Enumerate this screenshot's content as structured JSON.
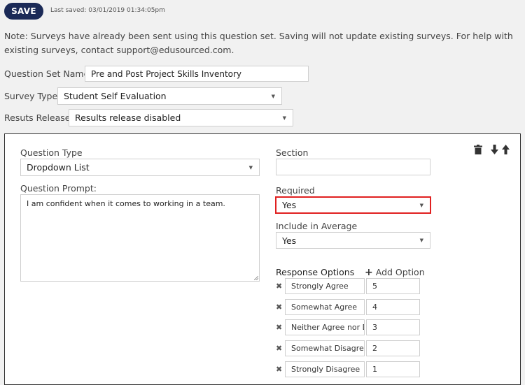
{
  "toolbar": {
    "save_label": "SAVE",
    "last_saved": "Last saved: 03/01/2019 01:34:05pm"
  },
  "note": "Note: Surveys have already been sent using this question set. Saving will not update existing surveys. For help with existing surveys, contact support@edusourced.com.",
  "question_set": {
    "label": "Question Set Name:",
    "value": "Pre and Post Project Skills Inventory"
  },
  "survey_type": {
    "label": "Survey Type:",
    "value": "Student Self Evaluation"
  },
  "results_release": {
    "label": "Resuts Release:",
    "value": "Results release disabled"
  },
  "question": {
    "type_label": "Question Type",
    "type_value": "Dropdown List",
    "prompt_label": "Question Prompt:",
    "prompt_value": "I am confident when it comes to working in a team.",
    "section_label": "Section",
    "section_value": "",
    "required_label": "Required",
    "required_value": "Yes",
    "include_label": "Include in Average",
    "include_value": "Yes",
    "response_label": "Response Options",
    "add_option_label": "Add Option",
    "options": [
      {
        "text": "Strongly Agree",
        "value": "5"
      },
      {
        "text": "Somewhat Agree",
        "value": "4"
      },
      {
        "text": "Neither Agree nor Di",
        "value": "3"
      },
      {
        "text": "Somewhat Disagree",
        "value": "2"
      },
      {
        "text": "Strongly Disagree",
        "value": "1"
      }
    ]
  },
  "colors": {
    "save_bg": "#1b2a57",
    "highlight": "#e02020"
  },
  "icons": {
    "delete": "trash-icon",
    "move_down": "arrow-down-icon",
    "move_up": "arrow-up-icon",
    "remove_option": "close-icon",
    "add": "plus-icon",
    "dropdown": "caret-down-icon"
  }
}
